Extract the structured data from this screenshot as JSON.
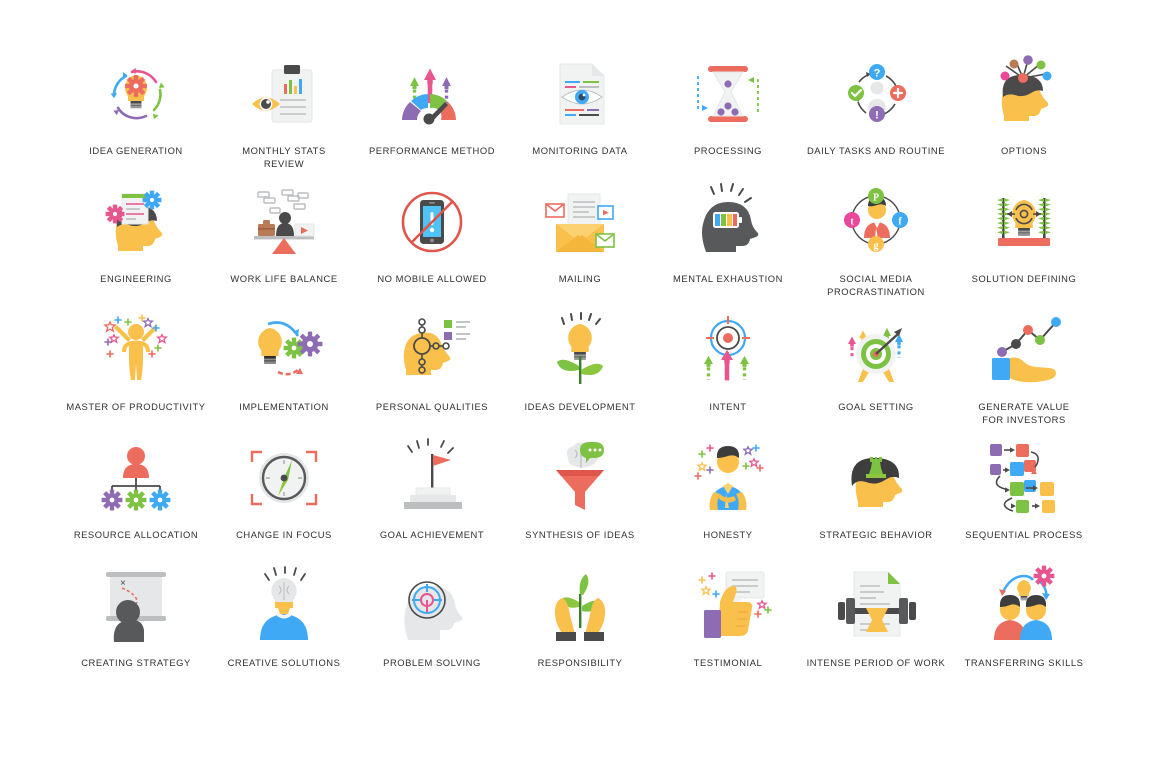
{
  "page": {
    "title": "Productivity & Business Flat Icon Set",
    "background": "#ffffff",
    "label_color": "#2f3033",
    "columns": 7,
    "rows": 5,
    "icon_count": 35
  },
  "palette": {
    "yellow": "#F9C04C",
    "yellow_light": "#FBD171",
    "red": "#EC6C5E",
    "red_dark": "#E0564A",
    "green": "#7DC242",
    "green_light": "#8CC63F",
    "blue": "#3FA9F5",
    "blue_light": "#4FC3F7",
    "purple": "#8E6CB4",
    "purple_light": "#9B7FC4",
    "pink": "#EC4899",
    "magenta": "#E8568F",
    "dark": "#4A4A4A",
    "dark_head": "#58595B",
    "gray": "#E6E7E8",
    "gray_light": "#F1F2F2",
    "gray_mid": "#BCBEC0",
    "orange": "#F7941E",
    "skin": "#F9C680"
  },
  "icons": [
    {
      "id": "idea-generation",
      "label": "IDEA GENERATION",
      "row": 1,
      "col": 1
    },
    {
      "id": "monthly-stats-review",
      "label": "MONTHLY STATS\nREVIEW",
      "row": 1,
      "col": 2
    },
    {
      "id": "performance-method",
      "label": "PERFORMANCE METHOD",
      "row": 1,
      "col": 3
    },
    {
      "id": "monitoring-data",
      "label": "MONITORING DATA",
      "row": 1,
      "col": 4
    },
    {
      "id": "processing",
      "label": "PROCESSING",
      "row": 1,
      "col": 5
    },
    {
      "id": "daily-tasks-and-routine",
      "label": "DAILY TASKS AND ROUTINE",
      "row": 1,
      "col": 6
    },
    {
      "id": "options",
      "label": "OPTIONS",
      "row": 1,
      "col": 7
    },
    {
      "id": "engineering",
      "label": "ENGINEERING",
      "row": 2,
      "col": 1
    },
    {
      "id": "work-life-balance",
      "label": "WORK LIFE BALANCE",
      "row": 2,
      "col": 2
    },
    {
      "id": "no-mobile-allowed",
      "label": "NO MOBILE ALLOWED",
      "row": 2,
      "col": 3
    },
    {
      "id": "mailing",
      "label": "MAILING",
      "row": 2,
      "col": 4
    },
    {
      "id": "mental-exhaustion",
      "label": "MENTAL EXHAUSTION",
      "row": 2,
      "col": 5
    },
    {
      "id": "social-media-procrastination",
      "label": "SOCIAL MEDIA\nPROCRASTINATION",
      "row": 2,
      "col": 6
    },
    {
      "id": "solution-defining",
      "label": "SOLUTION DEFINING",
      "row": 2,
      "col": 7
    },
    {
      "id": "master-of-productivity",
      "label": "MASTER OF PRODUCTIVITY",
      "row": 3,
      "col": 1
    },
    {
      "id": "implementation",
      "label": "IMPLEMENTATION",
      "row": 3,
      "col": 2
    },
    {
      "id": "personal-qualities",
      "label": "PERSONAL QUALITIES",
      "row": 3,
      "col": 3
    },
    {
      "id": "ideas-development",
      "label": "IDEAS DEVELOPMENT",
      "row": 3,
      "col": 4
    },
    {
      "id": "intent",
      "label": "INTENT",
      "row": 3,
      "col": 5
    },
    {
      "id": "goal-setting",
      "label": "GOAL SETTING",
      "row": 3,
      "col": 6
    },
    {
      "id": "generate-value-for-investors",
      "label": "GENERATE VALUE\nFOR INVESTORS",
      "row": 3,
      "col": 7
    },
    {
      "id": "resource-allocation",
      "label": "RESOURCE ALLOCATION",
      "row": 4,
      "col": 1
    },
    {
      "id": "change-in-focus",
      "label": "CHANGE IN FOCUS",
      "row": 4,
      "col": 2
    },
    {
      "id": "goal-achievement",
      "label": "GOAL ACHIEVEMENT",
      "row": 4,
      "col": 3
    },
    {
      "id": "synthesis-of-ideas",
      "label": "SYNTHESIS OF IDEAS",
      "row": 4,
      "col": 4
    },
    {
      "id": "honesty",
      "label": "HONESTY",
      "row": 4,
      "col": 5
    },
    {
      "id": "strategic-behavior",
      "label": "STRATEGIC BEHAVIOR",
      "row": 4,
      "col": 6
    },
    {
      "id": "sequential-process",
      "label": "SEQUENTIAL PROCESS",
      "row": 4,
      "col": 7
    },
    {
      "id": "creating-strategy",
      "label": "CREATING STRATEGY",
      "row": 5,
      "col": 1
    },
    {
      "id": "creative-solutions",
      "label": "CREATIVE SOLUTIONS",
      "row": 5,
      "col": 2
    },
    {
      "id": "problem-solving",
      "label": "PROBLEM SOLVING",
      "row": 5,
      "col": 3
    },
    {
      "id": "responsibility",
      "label": "RESPONSIBILITY",
      "row": 5,
      "col": 4
    },
    {
      "id": "testimonial",
      "label": "TESTIMONIAL",
      "row": 5,
      "col": 5
    },
    {
      "id": "intense-period-of-work",
      "label": "INTENSE PERIOD OF WORK",
      "row": 5,
      "col": 6
    },
    {
      "id": "transferring-skills",
      "label": "TRANSFERRING SKILLS",
      "row": 5,
      "col": 7
    }
  ]
}
